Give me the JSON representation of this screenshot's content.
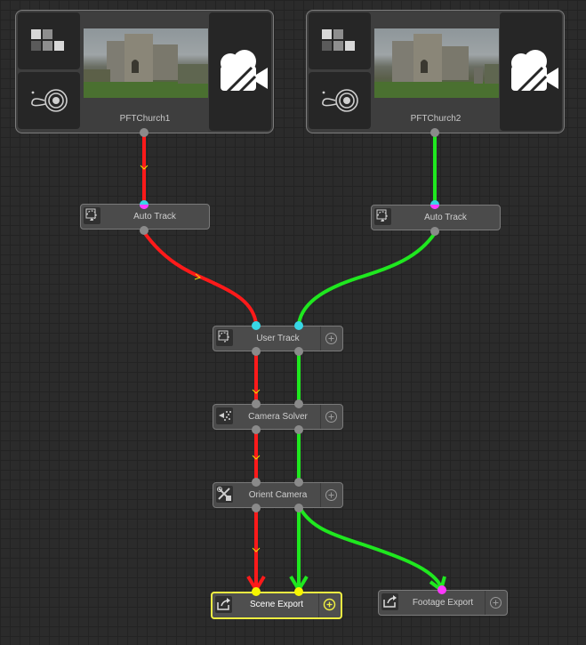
{
  "clips": [
    {
      "label": "PFTChurch1"
    },
    {
      "label": "PFTChurch2"
    }
  ],
  "nodes": {
    "auto_track_1": {
      "label": "Auto Track"
    },
    "auto_track_2": {
      "label": "Auto Track"
    },
    "user_track": {
      "label": "User Track"
    },
    "camera_solver": {
      "label": "Camera Solver"
    },
    "orient_camera": {
      "label": "Orient Camera"
    },
    "scene_export": {
      "label": "Scene Export"
    },
    "footage_export": {
      "label": "Footage Export"
    }
  },
  "colors": {
    "wire_red": "#ff1a1a",
    "wire_green": "#1fe81f",
    "port_grey": "#8a8a8a",
    "port_cyan": "#38d6e6",
    "port_magenta": "#ff38ff",
    "port_yellow": "#f5f500",
    "selected_border": "#f0f042"
  }
}
